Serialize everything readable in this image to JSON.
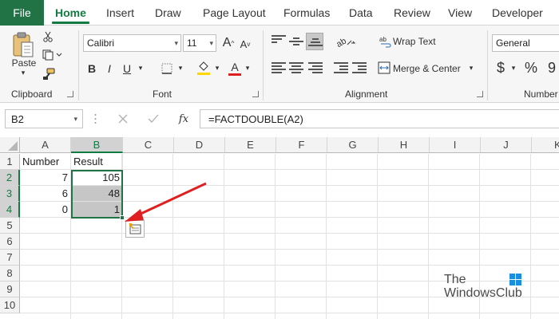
{
  "tabs": [
    "File",
    "Home",
    "Insert",
    "Draw",
    "Page Layout",
    "Formulas",
    "Data",
    "Review",
    "View",
    "Developer"
  ],
  "ribbon": {
    "clipboard": {
      "label": "Clipboard",
      "paste_label": "Paste"
    },
    "font": {
      "label": "Font",
      "font_name": "Calibri",
      "font_size": "11",
      "bold": "B",
      "italic": "I",
      "underline": "U",
      "grow_font": "A",
      "shrink_font": "A",
      "font_color": "A"
    },
    "alignment": {
      "label": "Alignment",
      "wrap_text": "Wrap Text",
      "merge_center": "Merge & Center"
    },
    "number": {
      "label": "Number",
      "format": "General",
      "currency": "$",
      "percent": "%",
      "comma": "9"
    }
  },
  "formula_bar": {
    "name_box": "B2",
    "formula": "=FACTDOUBLE(A2)",
    "fx": "fx"
  },
  "columns": [
    "A",
    "B",
    "C",
    "D",
    "E",
    "F",
    "G",
    "H",
    "I",
    "J",
    "K"
  ],
  "rows": [
    "1",
    "2",
    "3",
    "4",
    "5",
    "6",
    "7",
    "8",
    "9",
    "10"
  ],
  "cells": {
    "A1": "Number",
    "B1": "Result",
    "A2": "7",
    "B2": "105",
    "A3": "6",
    "B3": "48",
    "A4": "0",
    "B4": "1"
  },
  "watermark": {
    "line1": "The",
    "line2": "WindowsClub"
  },
  "colors": {
    "accent": "#217346",
    "tab_active": "#107c41",
    "arrow": "#e02020"
  },
  "icons": [
    "cut-icon",
    "copy-icon",
    "format-painter-icon",
    "fx-icon",
    "cancel-icon",
    "enter-icon",
    "autofill-options-icon"
  ]
}
